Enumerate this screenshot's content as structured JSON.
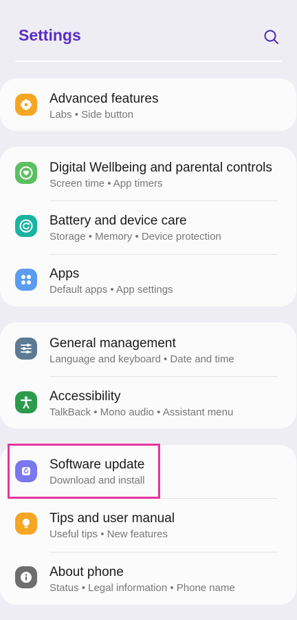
{
  "header": {
    "title": "Settings",
    "search_icon": "search-icon"
  },
  "items": {
    "advanced": {
      "label": "Advanced features",
      "sub": "Labs  •  Side button",
      "icon": "gear-flower-icon",
      "color": "#f5a623"
    },
    "wellbeing": {
      "label": "Digital Wellbeing and parental controls",
      "sub": "Screen time  •  App timers",
      "icon": "heart-circle-icon",
      "color": "#5dbf63"
    },
    "battery": {
      "label": "Battery and device care",
      "sub": "Storage  •  Memory  •  Device protection",
      "icon": "refresh-circle-icon",
      "color": "#1ab3a0"
    },
    "apps": {
      "label": "Apps",
      "sub": "Default apps  •  App settings",
      "icon": "grid-dots-icon",
      "color": "#5b9cf0"
    },
    "general": {
      "label": "General management",
      "sub": "Language and keyboard  •  Date and time",
      "icon": "sliders-icon",
      "color": "#5c7a93"
    },
    "accessibility": {
      "label": "Accessibility",
      "sub": "TalkBack  •  Mono audio  •  Assistant menu",
      "icon": "person-icon",
      "color": "#2d9b4d"
    },
    "software": {
      "label": "Software update",
      "sub": "Download and install",
      "icon": "update-icon",
      "color": "#7b77f0"
    },
    "tips": {
      "label": "Tips and user manual",
      "sub": "Useful tips  •  New features",
      "icon": "lightbulb-icon",
      "color": "#f5a623"
    },
    "about": {
      "label": "About phone",
      "sub": "Status  •  Legal information  •  Phone name",
      "icon": "info-icon",
      "color": "#6e6e6e"
    }
  },
  "highlight_color": "#e4349e"
}
